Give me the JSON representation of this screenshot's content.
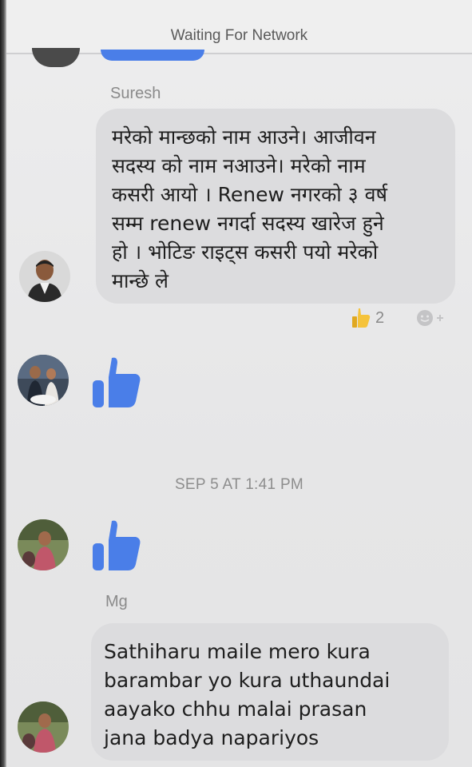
{
  "status": {
    "text": "Waiting For Network"
  },
  "messages": [
    {
      "sender": "Suresh",
      "text": "मरेको मान्छको नाम आउने। आजीवन\nसदस्य को नाम नआउने। मरेको नाम\nकसरी आयो ।  Renew नगरको ३ वर्ष\nसम्म renew नगर्दा सदस्य खारेज हुने\nहो । भोटिङ राइट्स कसरी पयो मरेको\nमान्छे ले",
      "reaction_icon": "thumbs-up-emoji",
      "reaction_count": "2",
      "add_reaction_icon": "add-reaction-icon"
    },
    {
      "sender": "Mg",
      "text": "Sathiharu maile mero kura\nbarambar yo kura uthaundai\naayako chhu malai prasan\njana badya napariyos"
    }
  ],
  "timestamp": "SEP 5 AT 1:41 PM",
  "colors": {
    "like_blue": "#4a7ee8",
    "bubble_gray": "#dcdcde",
    "reaction_yellow": "#f5c33b"
  },
  "icons": {
    "like": "thumbs-up-icon"
  }
}
